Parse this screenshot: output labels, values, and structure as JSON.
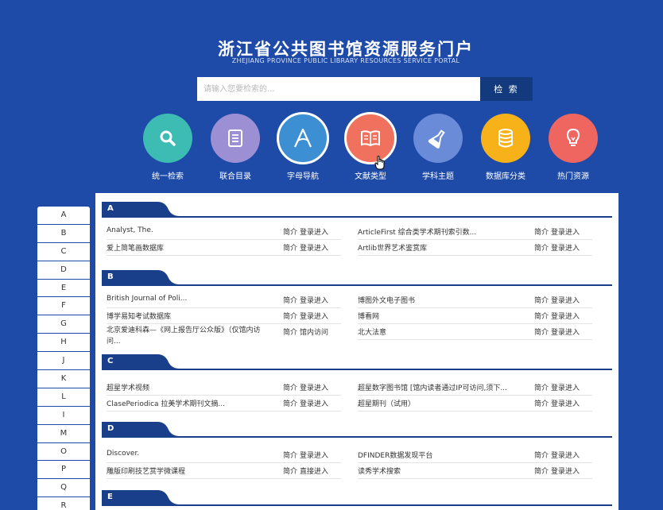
{
  "header": {
    "title": "浙江省公共图书馆资源服务门户",
    "subtitle": "ZHEJIANG PROVINCE PUBLIC LIBRARY RESOURCES SERVICE PORTAL"
  },
  "search": {
    "placeholder": "请输入您要检索的...",
    "value": "",
    "button_label": "检 索"
  },
  "nav": [
    {
      "label": "统一检索",
      "icon": "search-icon",
      "color": "#3cbcb2"
    },
    {
      "label": "联合目录",
      "icon": "list-icon",
      "color": "#9d8fd4"
    },
    {
      "label": "字母导航",
      "icon": "letter-a-icon",
      "color": "#3d8fd3"
    },
    {
      "label": "文献类型",
      "icon": "book-icon",
      "color": "#f0725e"
    },
    {
      "label": "学科主题",
      "icon": "flask-icon",
      "color": "#6a8bd8"
    },
    {
      "label": "数据库分类",
      "icon": "database-icon",
      "color": "#f7b21a"
    },
    {
      "label": "热门资源",
      "icon": "lightbulb-icon",
      "color": "#ef6660"
    }
  ],
  "alphabet": [
    "A",
    "B",
    "C",
    "D",
    "E",
    "F",
    "G",
    "H",
    "J",
    "K",
    "L",
    "I",
    "M",
    "O",
    "P",
    "Q",
    "R"
  ],
  "sections": [
    {
      "letter": "A",
      "items": [
        {
          "title": "Analyst, The.",
          "intro": "简介",
          "enter": "登录进入"
        },
        {
          "title": "ArticleFirst 综合类学术期刊索引数...",
          "intro": "简介",
          "enter": "登录进入"
        },
        {
          "title": "爱上简笔画数据库",
          "intro": "简介",
          "enter": "登录进入"
        },
        {
          "title": "Artlib世界艺术鉴赏库",
          "intro": "简介",
          "enter": "登录进入"
        }
      ]
    },
    {
      "letter": "B",
      "items": [
        {
          "title": "British Journal of Poli...",
          "intro": "简介",
          "enter": "登录进入"
        },
        {
          "title": "博图外文电子图书",
          "intro": "简介",
          "enter": "登录进入"
        },
        {
          "title": "博学易知考试数据库",
          "intro": "简介",
          "enter": "登录进入"
        },
        {
          "title": "博看网",
          "intro": "简介",
          "enter": "登录进入"
        },
        {
          "title": "北京爱迪科森—《网上报告厅公众版》（仅馆内访问...",
          "intro": "简介",
          "enter": "馆内访问"
        },
        {
          "title": "北大法意",
          "intro": "简介",
          "enter": "登录进入"
        }
      ]
    },
    {
      "letter": "C",
      "items": [
        {
          "title": "超星学术视频",
          "intro": "简介",
          "enter": "登录进入"
        },
        {
          "title": "超星数字图书馆 [馆内读者通过IP可访问,须下...",
          "intro": "简介",
          "enter": "登录进入"
        },
        {
          "title": "ClasePeriodica 拉美学术期刊文摘...",
          "intro": "简介",
          "enter": "登录进入"
        },
        {
          "title": "超星期刊（试用）",
          "intro": "简介",
          "enter": "登录进入"
        }
      ]
    },
    {
      "letter": "D",
      "items": [
        {
          "title": "Discover.",
          "intro": "简介",
          "enter": "登录进入"
        },
        {
          "title": "DFINDER数据发现平台",
          "intro": "简介",
          "enter": "登录进入"
        },
        {
          "title": "雕版印刷技艺赏学微课程",
          "intro": "简介",
          "enter": "直接进入"
        },
        {
          "title": "读秀学术搜索",
          "intro": "简介",
          "enter": "登录进入"
        }
      ]
    },
    {
      "letter": "E",
      "items": []
    }
  ],
  "colors": {
    "background": "#1e4ba8",
    "section_tab": "#1a3f8a",
    "search_button": "#123a7c"
  }
}
